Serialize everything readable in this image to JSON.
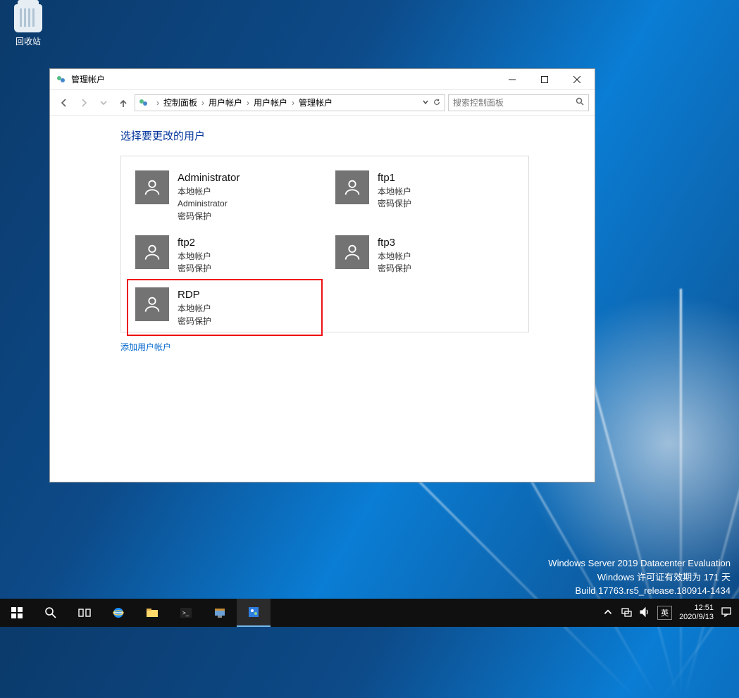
{
  "desktop": {
    "recycle_bin": "回收站"
  },
  "window": {
    "title": "管理帐户",
    "breadcrumb": [
      "控制面板",
      "用户帐户",
      "用户帐户",
      "管理帐户"
    ],
    "search_placeholder": "搜索控制面板",
    "heading": "选择要更改的用户",
    "add_link": "添加用户帐户",
    "users": [
      {
        "name": "Administrator",
        "lines": [
          "本地帐户",
          "Administrator",
          "密码保护"
        ],
        "highlight": false
      },
      {
        "name": "ftp1",
        "lines": [
          "本地帐户",
          "密码保护"
        ],
        "highlight": false
      },
      {
        "name": "ftp2",
        "lines": [
          "本地帐户",
          "密码保护"
        ],
        "highlight": false
      },
      {
        "name": "ftp3",
        "lines": [
          "本地帐户",
          "密码保护"
        ],
        "highlight": false
      },
      {
        "name": "RDP",
        "lines": [
          "本地帐户",
          "密码保护"
        ],
        "highlight": true
      }
    ]
  },
  "watermark": {
    "line1": "Windows Server 2019 Datacenter Evaluation",
    "line2": "Windows 许可证有效期为 171 天",
    "line3": "Build 17763.rs5_release.180914-1434"
  },
  "tray": {
    "time": "12:51",
    "date": "2020/9/13",
    "ime": "英"
  }
}
